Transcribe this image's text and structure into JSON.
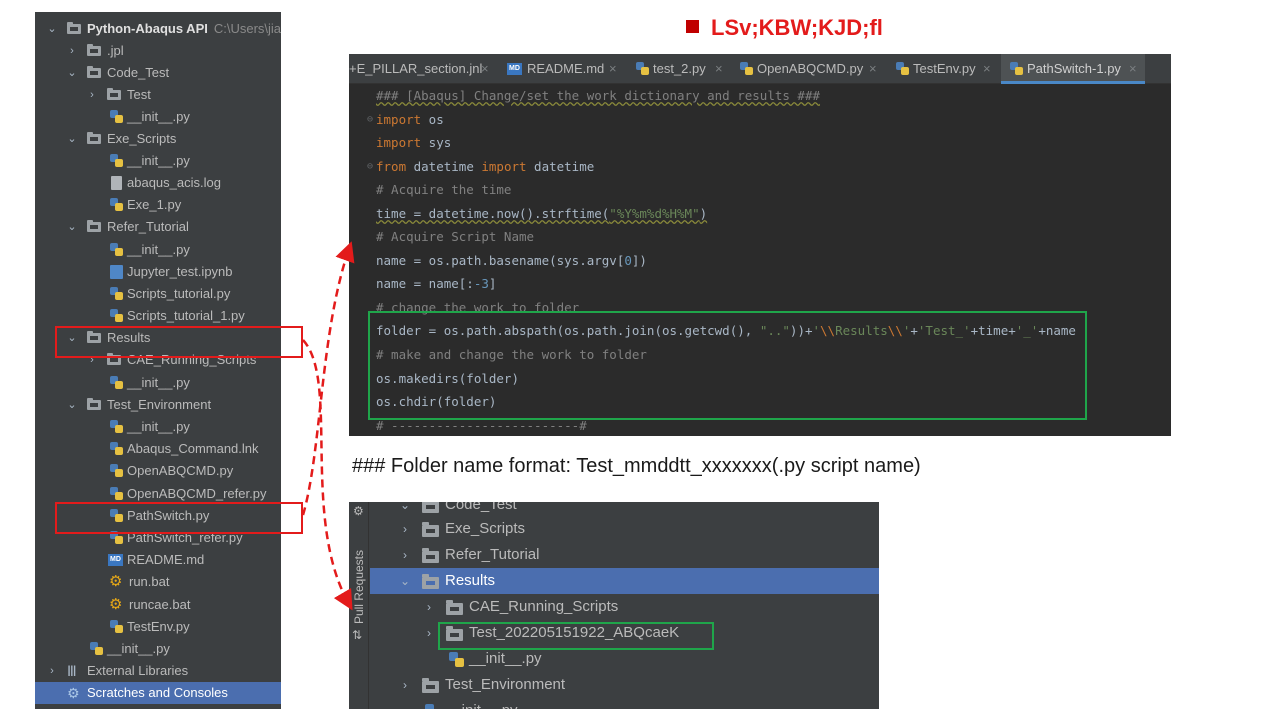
{
  "title": "LSv;KBW;KJD;fl",
  "project_tree": {
    "root_label": "Python-Abaqus API",
    "root_path": "C:\\Users\\jia",
    "items": [
      {
        "label": ".jpl"
      },
      {
        "label": "Code_Test"
      },
      {
        "label": "Test"
      },
      {
        "label": "__init__.py"
      },
      {
        "label": "Exe_Scripts"
      },
      {
        "label": "__init__.py"
      },
      {
        "label": "abaqus_acis.log"
      },
      {
        "label": "Exe_1.py"
      },
      {
        "label": "Refer_Tutorial"
      },
      {
        "label": "__init__.py"
      },
      {
        "label": "Jupyter_test.ipynb"
      },
      {
        "label": "Scripts_tutorial.py"
      },
      {
        "label": "Scripts_tutorial_1.py"
      },
      {
        "label": "Results"
      },
      {
        "label": "CAE_Running_Scripts"
      },
      {
        "label": "__init__.py"
      },
      {
        "label": "Test_Environment"
      },
      {
        "label": "__init__.py"
      },
      {
        "label": "Abaqus_Command.lnk"
      },
      {
        "label": "OpenABQCMD.py"
      },
      {
        "label": "OpenABQCMD_refer.py"
      },
      {
        "label": "PathSwitch.py"
      },
      {
        "label": "PathSwitch_refer.py"
      },
      {
        "label": "README.md"
      },
      {
        "label": "run.bat"
      },
      {
        "label": "runcae.bat"
      },
      {
        "label": "TestEnv.py"
      },
      {
        "label": "__init__.py"
      },
      {
        "label": "External Libraries"
      },
      {
        "label": "Scratches and Consoles"
      }
    ]
  },
  "editor": {
    "tabs": [
      {
        "label": "+E_PILLAR_section.jnl"
      },
      {
        "label": "README.md"
      },
      {
        "label": "test_2.py"
      },
      {
        "label": "OpenABQCMD.py"
      },
      {
        "label": "TestEnv.py"
      },
      {
        "label": "PathSwitch-1.py"
      }
    ],
    "code": {
      "l1": "### [Abaqus] Change/set the work dictionary and results ###",
      "l2_kw": "import",
      "l2_rest": " os",
      "l3_kw": "import",
      "l3_rest": " sys",
      "l4_kw1": "from",
      "l4_mid": " datetime ",
      "l4_kw2": "import",
      "l4_rest": " datetime",
      "l5": "# Acquire the time",
      "l6_a": "time = datetime.now().strftime(",
      "l6_str": "\"%Y%m%d%H%M\"",
      "l6_b": ")",
      "l7": "# Acquire Script Name",
      "l8_a": "name = os.path.basename(sys.argv[",
      "l8_num": "0",
      "l8_b": "])",
      "l9_a": "name = name[:",
      "l9_num": "-3",
      "l9_b": "]",
      "l10": "# change the work to folder",
      "l11_a": "folder = os.path.abspath(os.path.join(os.getcwd(), ",
      "l11_s1": "\"..\"",
      "l11_b": "))+",
      "l11_s2a": "'",
      "l11_e1": "\\\\",
      "l11_s2b": "Results",
      "l11_e2": "\\\\",
      "l11_s2c": "'",
      "l11_c": "+",
      "l11_s3": "'Test_'",
      "l11_d": "+time+",
      "l11_s4": "'_'",
      "l11_e": "+name",
      "l12": "# make and change the work to folder",
      "l13": "os.makedirs(folder)",
      "l14": "os.chdir(folder)",
      "l15": "# -------------------------#"
    }
  },
  "caption": "### Folder name format: Test_mmddtt_xxxxxxx(.py script name)",
  "results_panel": {
    "side_label": "Pull Requests",
    "items": [
      {
        "label": "Code_Test"
      },
      {
        "label": "Exe_Scripts"
      },
      {
        "label": "Refer_Tutorial"
      },
      {
        "label": "Results"
      },
      {
        "label": "CAE_Running_Scripts"
      },
      {
        "label": "Test_202205151922_ABQcaeK"
      },
      {
        "label": "__init__.py"
      },
      {
        "label": "Test_Environment"
      },
      {
        "label": "__init__.py"
      }
    ]
  },
  "colors": {
    "highlight_red": "#e31b1b",
    "highlight_green": "#1fa54a",
    "ide_bg": "#3c3f41",
    "editor_bg": "#2b2b2b",
    "selection": "#4b6eaf"
  }
}
